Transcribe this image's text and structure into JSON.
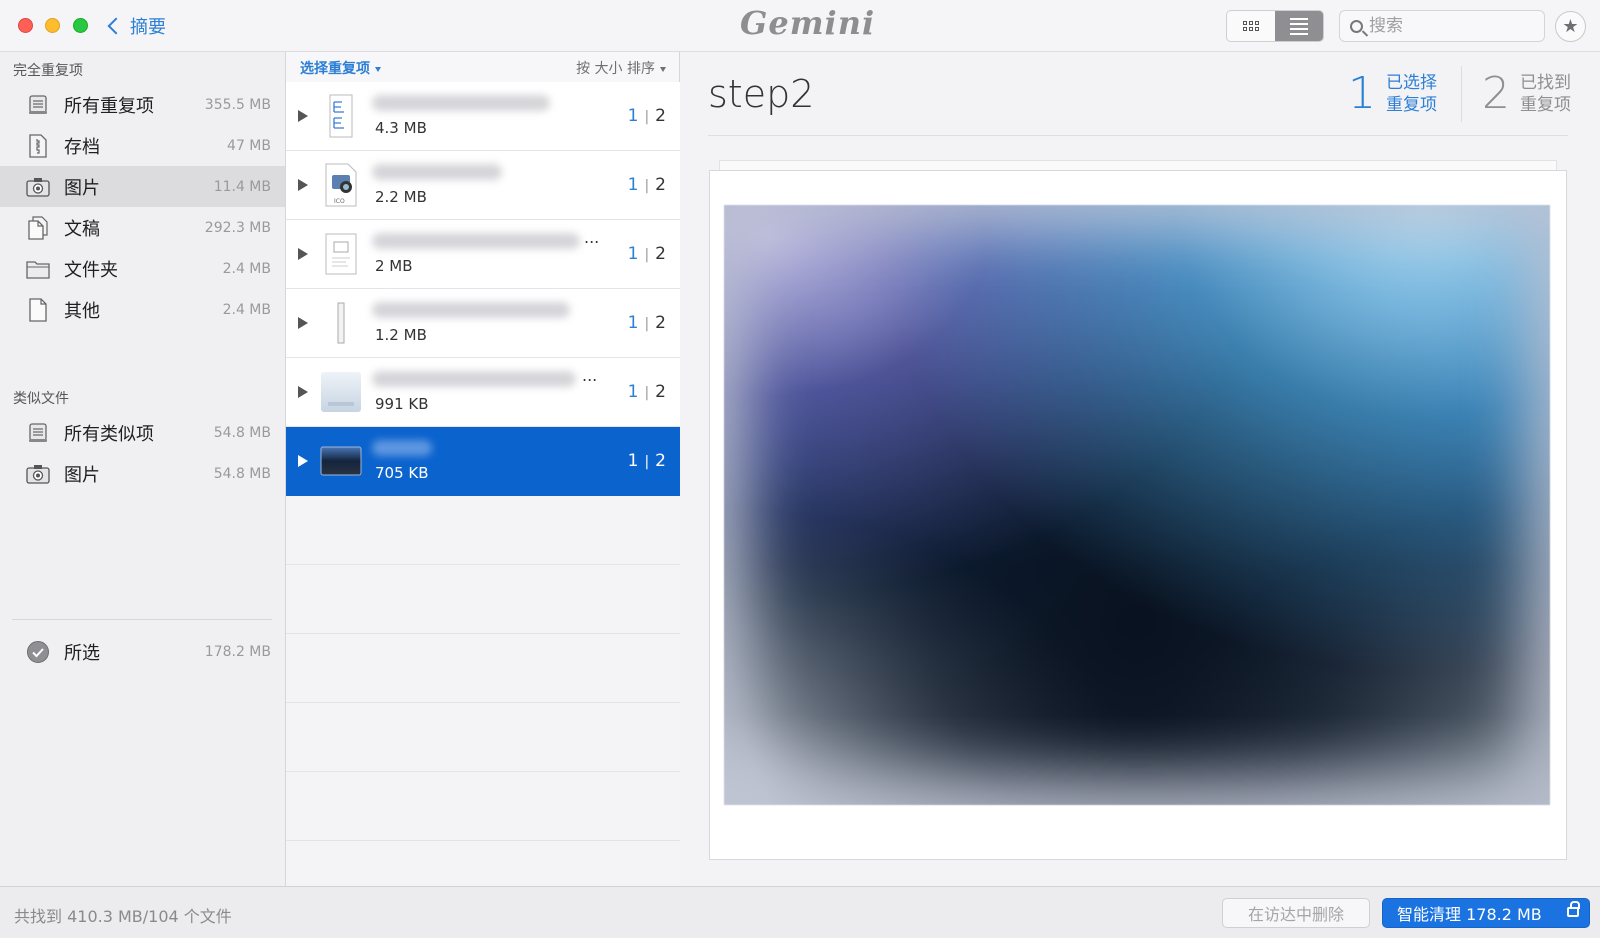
{
  "titlebar": {
    "back_label": "摘要",
    "logo_text": "Gemini",
    "search_placeholder": "搜索"
  },
  "sidebar": {
    "section_duplicates": "完全重复项",
    "duplicates": [
      {
        "label": "所有重复项",
        "size": "355.5 MB",
        "icon": "stack-icon"
      },
      {
        "label": "存档",
        "size": "47 MB",
        "icon": "archive-icon"
      },
      {
        "label": "图片",
        "size": "11.4 MB",
        "icon": "camera-icon",
        "selected": true
      },
      {
        "label": "文稿",
        "size": "292.3 MB",
        "icon": "document-icon"
      },
      {
        "label": "文件夹",
        "size": "2.4 MB",
        "icon": "folder-icon"
      },
      {
        "label": "其他",
        "size": "2.4 MB",
        "icon": "file-icon"
      }
    ],
    "section_similar": "类似文件",
    "similar": [
      {
        "label": "所有类似项",
        "size": "54.8 MB",
        "icon": "stack-icon"
      },
      {
        "label": "图片",
        "size": "54.8 MB",
        "icon": "camera-icon"
      }
    ],
    "selected_item": {
      "label": "所选",
      "size": "178.2 MB",
      "icon": "checkmark-circle-icon"
    }
  },
  "list": {
    "select_label": "选择重复项",
    "sort_label": "按 大小 排序",
    "rows": [
      {
        "size": "4.3 MB",
        "selected_count": "1",
        "total_count": "2"
      },
      {
        "size": "2.2 MB",
        "selected_count": "1",
        "total_count": "2"
      },
      {
        "size": "2 MB",
        "selected_count": "1",
        "total_count": "2",
        "ellipsis": "..."
      },
      {
        "size": "1.2 MB",
        "selected_count": "1",
        "total_count": "2"
      },
      {
        "size": "991 KB",
        "selected_count": "1",
        "total_count": "2",
        "ellipsis": "..."
      },
      {
        "size": "705 KB",
        "selected_count": "1",
        "total_count": "2",
        "selected": true
      }
    ]
  },
  "detail": {
    "title": "step2",
    "selected_count": "1",
    "selected_label_1": "已选择",
    "selected_label_2": "重复项",
    "found_count": "2",
    "found_label_1": "已找到",
    "found_label_2": "重复项"
  },
  "bottom": {
    "summary": "共找到 410.3 MB/104 个文件",
    "finder_delete_label": "在访达中删除",
    "smart_clean_label": "智能清理 178.2 MB"
  },
  "colors": {
    "accent": "#2d7fd6",
    "selection": "#0b63ce",
    "smart_button": "#1a73e0"
  }
}
